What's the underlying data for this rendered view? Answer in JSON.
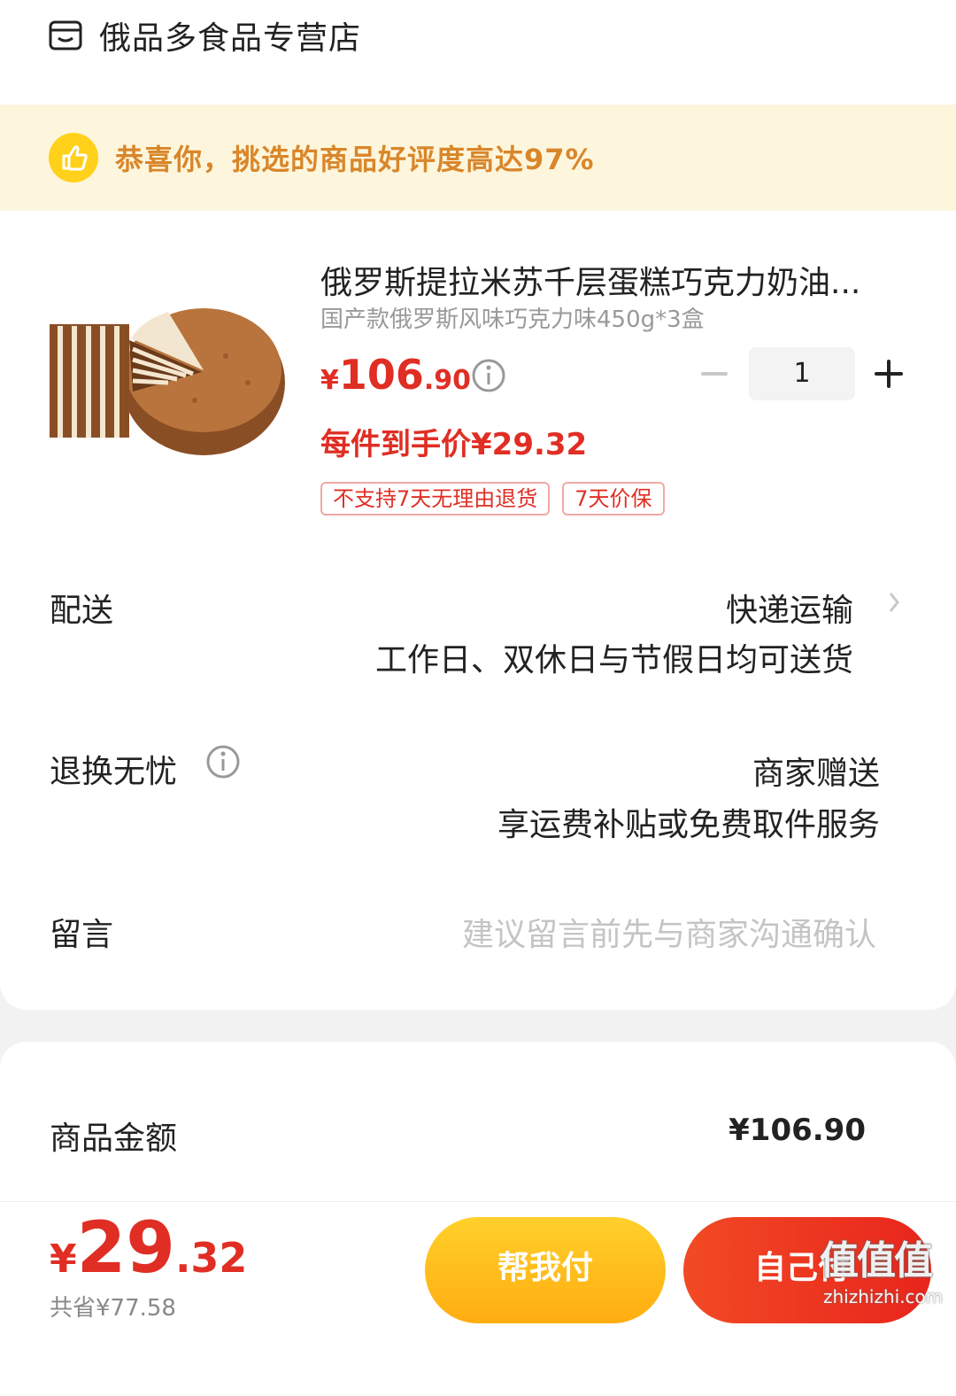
{
  "store": {
    "name": "俄品多食品专营店",
    "icon": "store-icon"
  },
  "banner": {
    "icon": "thumbs-up-icon",
    "text": "恭喜你，挑选的商品好评度高达97%",
    "color": "#d9862a"
  },
  "product": {
    "title": "俄罗斯提拉米苏千层蛋糕巧克力奶油...",
    "sku": "国产款俄罗斯风味巧克力味450g*3盒",
    "price_symbol": "¥",
    "price_int": "106",
    "price_dec": ".90",
    "unit_price": "每件到手价¥29.32",
    "quantity": "1",
    "tags": [
      "不支持7天无理由退货",
      "7天价保"
    ],
    "price_color": "#e02e24"
  },
  "delivery": {
    "label": "配送",
    "method": "快递运输",
    "detail": "工作日、双休日与节假日均可送货"
  },
  "returns": {
    "label": "退换无忧",
    "value": "商家赠送",
    "detail": "享运费补贴或免费取件服务"
  },
  "remark": {
    "label": "留言",
    "placeholder": "建议留言前先与商家沟通确认"
  },
  "summary": {
    "goods_label": "商品金额",
    "goods_value": "¥106.90"
  },
  "footer": {
    "total_symbol": "¥",
    "total_int": "29",
    "total_dec": ".32",
    "saved": "共省¥77.58",
    "help_pay": "帮我付",
    "self_pay": "自己付"
  },
  "watermark": {
    "text": "值值值",
    "site": "zhizhizhi.com"
  }
}
